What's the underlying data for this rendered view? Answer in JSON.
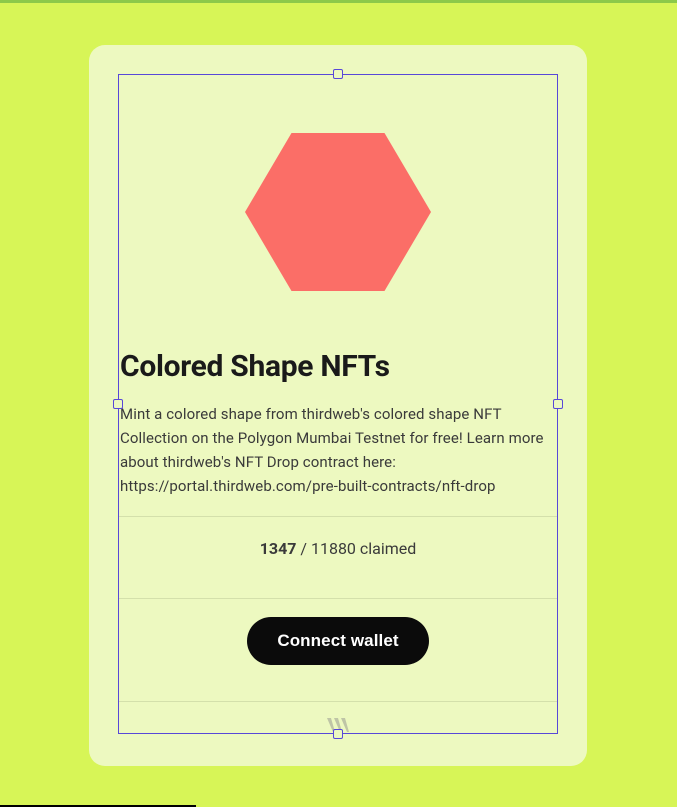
{
  "title": "Colored Shape NFTs",
  "description": "Mint a colored shape from thirdweb's colored shape NFT Collection on the Polygon Mumbai Testnet for free! Learn more about thirdweb's NFT Drop contract here: https://portal.thirdweb.com/pre-built-contracts/nft-drop",
  "stats": {
    "claimed": "1347",
    "total_text": " / 11880 claimed"
  },
  "button": {
    "connect_label": "Connect wallet"
  },
  "colors": {
    "page_bg": "#d7f557",
    "card_bg": "#edf9c0",
    "selection": "#5848d8",
    "hexagon": "#fb6e67",
    "button_bg": "#0b0b0b"
  },
  "image": {
    "shape": "hexagon"
  }
}
